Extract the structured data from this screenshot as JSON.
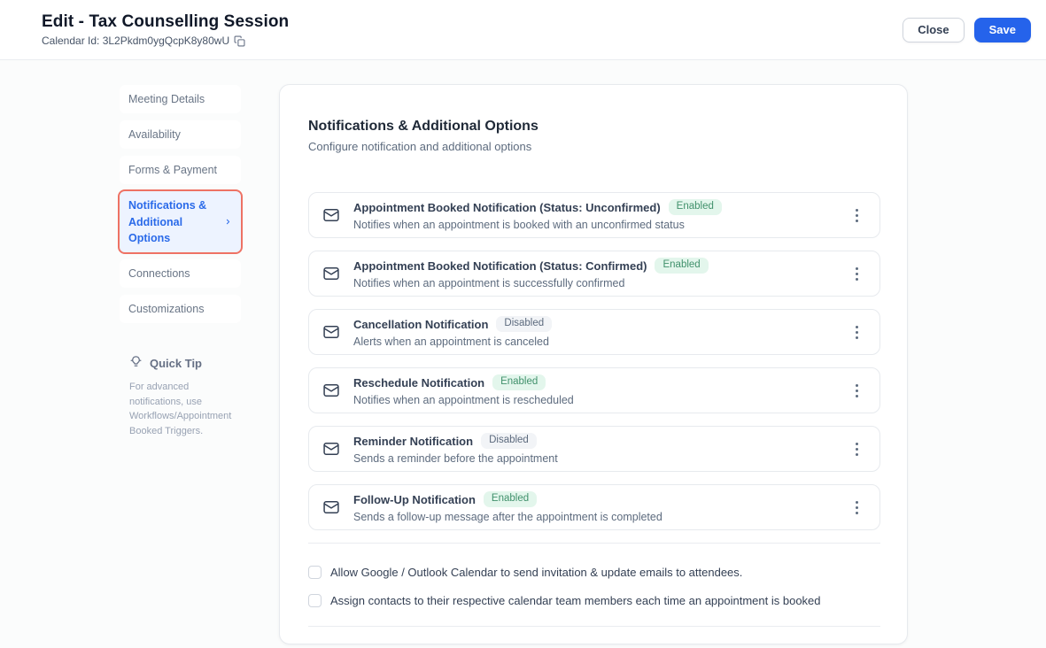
{
  "header": {
    "title": "Edit - Tax Counselling Session",
    "calendar_id": "Calendar Id: 3L2Pkdm0ygQcpK8y80wU",
    "close_label": "Close",
    "save_label": "Save"
  },
  "sidebar": {
    "items": [
      {
        "label": "Meeting Details",
        "active": false
      },
      {
        "label": "Availability",
        "active": false
      },
      {
        "label": "Forms & Payment",
        "active": false
      },
      {
        "label": "Notifications & Additional Options",
        "active": true
      },
      {
        "label": "Connections",
        "active": false
      },
      {
        "label": "Customizations",
        "active": false
      }
    ],
    "quick_tip": {
      "title": "Quick Tip",
      "body": "For advanced notifications, use Workflows/Appointment Booked Triggers."
    }
  },
  "main": {
    "title": "Notifications & Additional Options",
    "subtitle": "Configure notification and additional options",
    "notifications": [
      {
        "title": "Appointment Booked Notification (Status: Unconfirmed)",
        "status": "Enabled",
        "description": "Notifies when an appointment is booked with an unconfirmed status"
      },
      {
        "title": "Appointment Booked Notification (Status: Confirmed)",
        "status": "Enabled",
        "description": "Notifies when an appointment is successfully confirmed"
      },
      {
        "title": "Cancellation Notification",
        "status": "Disabled",
        "description": "Alerts when an appointment is canceled"
      },
      {
        "title": "Reschedule Notification",
        "status": "Enabled",
        "description": "Notifies when an appointment is rescheduled"
      },
      {
        "title": "Reminder Notification",
        "status": "Disabled",
        "description": "Sends a reminder before the appointment"
      },
      {
        "title": "Follow-Up Notification",
        "status": "Enabled",
        "description": "Sends a follow-up message after the appointment is completed"
      }
    ],
    "checkboxes": [
      {
        "label": "Allow Google / Outlook Calendar to send invitation & update emails to attendees.",
        "checked": false
      },
      {
        "label": "Assign contacts to their respective calendar team members each time an appointment is booked",
        "checked": false
      }
    ]
  },
  "icons": {
    "calendar_id": "copy",
    "notification_card": "mail-envelope",
    "active_nav": "chevron-right",
    "quick_tip": "lightbulb",
    "card_menu": "kebab-vertical-dots"
  },
  "colors": {
    "primary_button": "#2563eb",
    "active_nav_text": "#2a6ae9",
    "active_nav_bg": "#edf3ff",
    "active_nav_highlight_border": "#ee7264",
    "enabled_badge_bg": "#e3f6ec",
    "enabled_badge_text": "#41916c",
    "disabled_badge_bg": "#f2f4f7",
    "disabled_badge_text": "#5d6b7e"
  }
}
